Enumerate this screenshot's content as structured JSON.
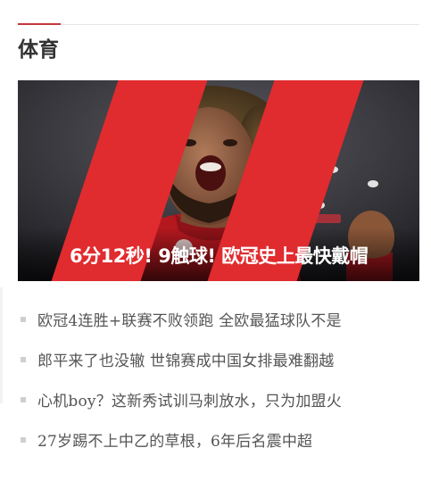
{
  "section": {
    "title": "体育"
  },
  "hero": {
    "title": "6分12秒! 9触球! 欧冠史上最快戴帽",
    "quote_icon": "double-slash-red-icon",
    "accent_color": "#e02b2f"
  },
  "news": [
    {
      "title": "欧冠4连胜+联赛不败领跑 全欧最猛球队不是"
    },
    {
      "title": "郎平来了也没辙 世锦赛成中国女排最难翻越"
    },
    {
      "title": "心机boy？这新秀试训马刺放水，只为加盟火"
    },
    {
      "title": "27岁踢不上中乙的草根，6年后名震中超"
    }
  ],
  "colors": {
    "accent": "#c6363a",
    "text": "#555555",
    "title": "#333333"
  }
}
